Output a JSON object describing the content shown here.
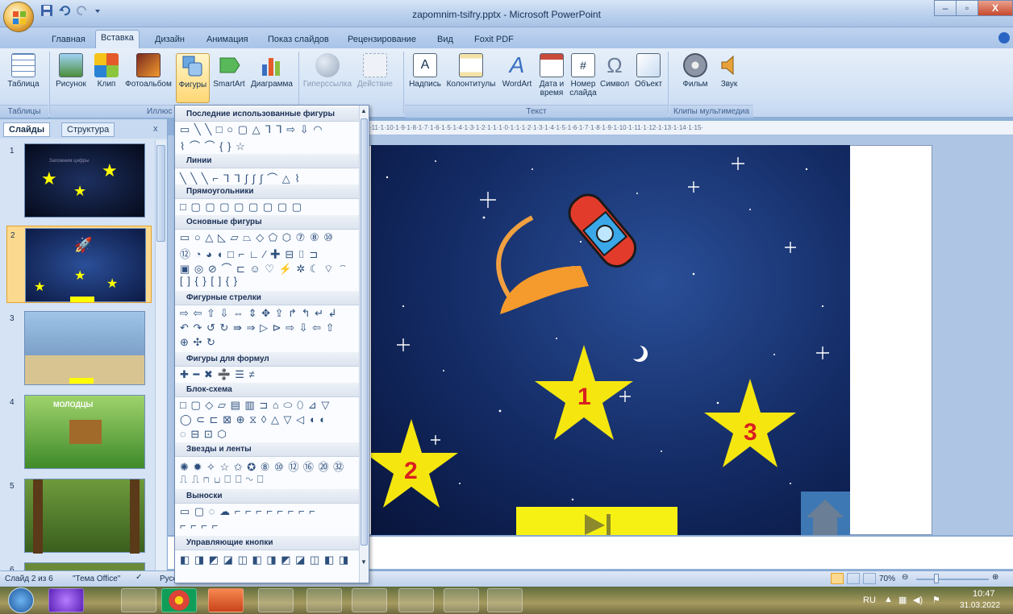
{
  "window": {
    "title": "zapomnim-tsifry.pptx - Microsoft PowerPoint"
  },
  "tabs": [
    "Главная",
    "Вставка",
    "Дизайн",
    "Анимация",
    "Показ слайдов",
    "Рецензирование",
    "Вид",
    "Foxit PDF"
  ],
  "ribbon": {
    "buttons": {
      "table": "Таблица",
      "picture": "Рисунок",
      "clip": "Клип",
      "album": "Фотоальбом",
      "shapes": "Фигуры",
      "smartart": "SmartArt",
      "chart": "Диаграмма",
      "hyperlink": "Гиперссылка",
      "action": "Действие",
      "textbox": "Надпись",
      "header": "Колонтитулы",
      "wordart": "WordArt",
      "datetime": "Дата и время",
      "slidenum": "Номер слайда",
      "symbol": "Символ",
      "object": "Объект",
      "movie": "Фильм",
      "sound": "Звук"
    },
    "groups": {
      "tables": "Таблицы",
      "illustrations": "Иллюс",
      "text": "Текст",
      "media": "Клипы мультимедиа"
    }
  },
  "panel": {
    "tabs": [
      "Слайды",
      "Структура"
    ],
    "slide_numbers": [
      "1",
      "2",
      "3",
      "4",
      "5",
      "6"
    ],
    "slide1_title": "Запомним цифры",
    "slide4_title": "МОЛОДЦЫ"
  },
  "gallery": {
    "sections": [
      "Последние использованные фигуры",
      "Линии",
      "Прямоугольники",
      "Основные фигуры",
      "Фигурные стрелки",
      "Фигуры для формул",
      "Блок-схема",
      "Звезды и ленты",
      "Выноски",
      "Управляющие кнопки"
    ]
  },
  "slide": {
    "star_labels": [
      "1",
      "2",
      "3"
    ]
  },
  "ruler_text": "·11·1·10·1·9·1·8·1·7·1·6·1·5·1·4·1·3·1·2·1·1·1·0·1·1·1·2·1·3·1·4·1·5·1·6·1·7·1·8·1·9·1·10·1·11·1·12·1·13·1·14·1·15·",
  "status": {
    "slide_info": "Слайд 2 из 6",
    "theme": "\"Тема Office\"",
    "language": "Русс",
    "zoom": "70%"
  },
  "taskbar": {
    "lang": "RU",
    "time": "10:47",
    "date": "31.03.2022"
  }
}
